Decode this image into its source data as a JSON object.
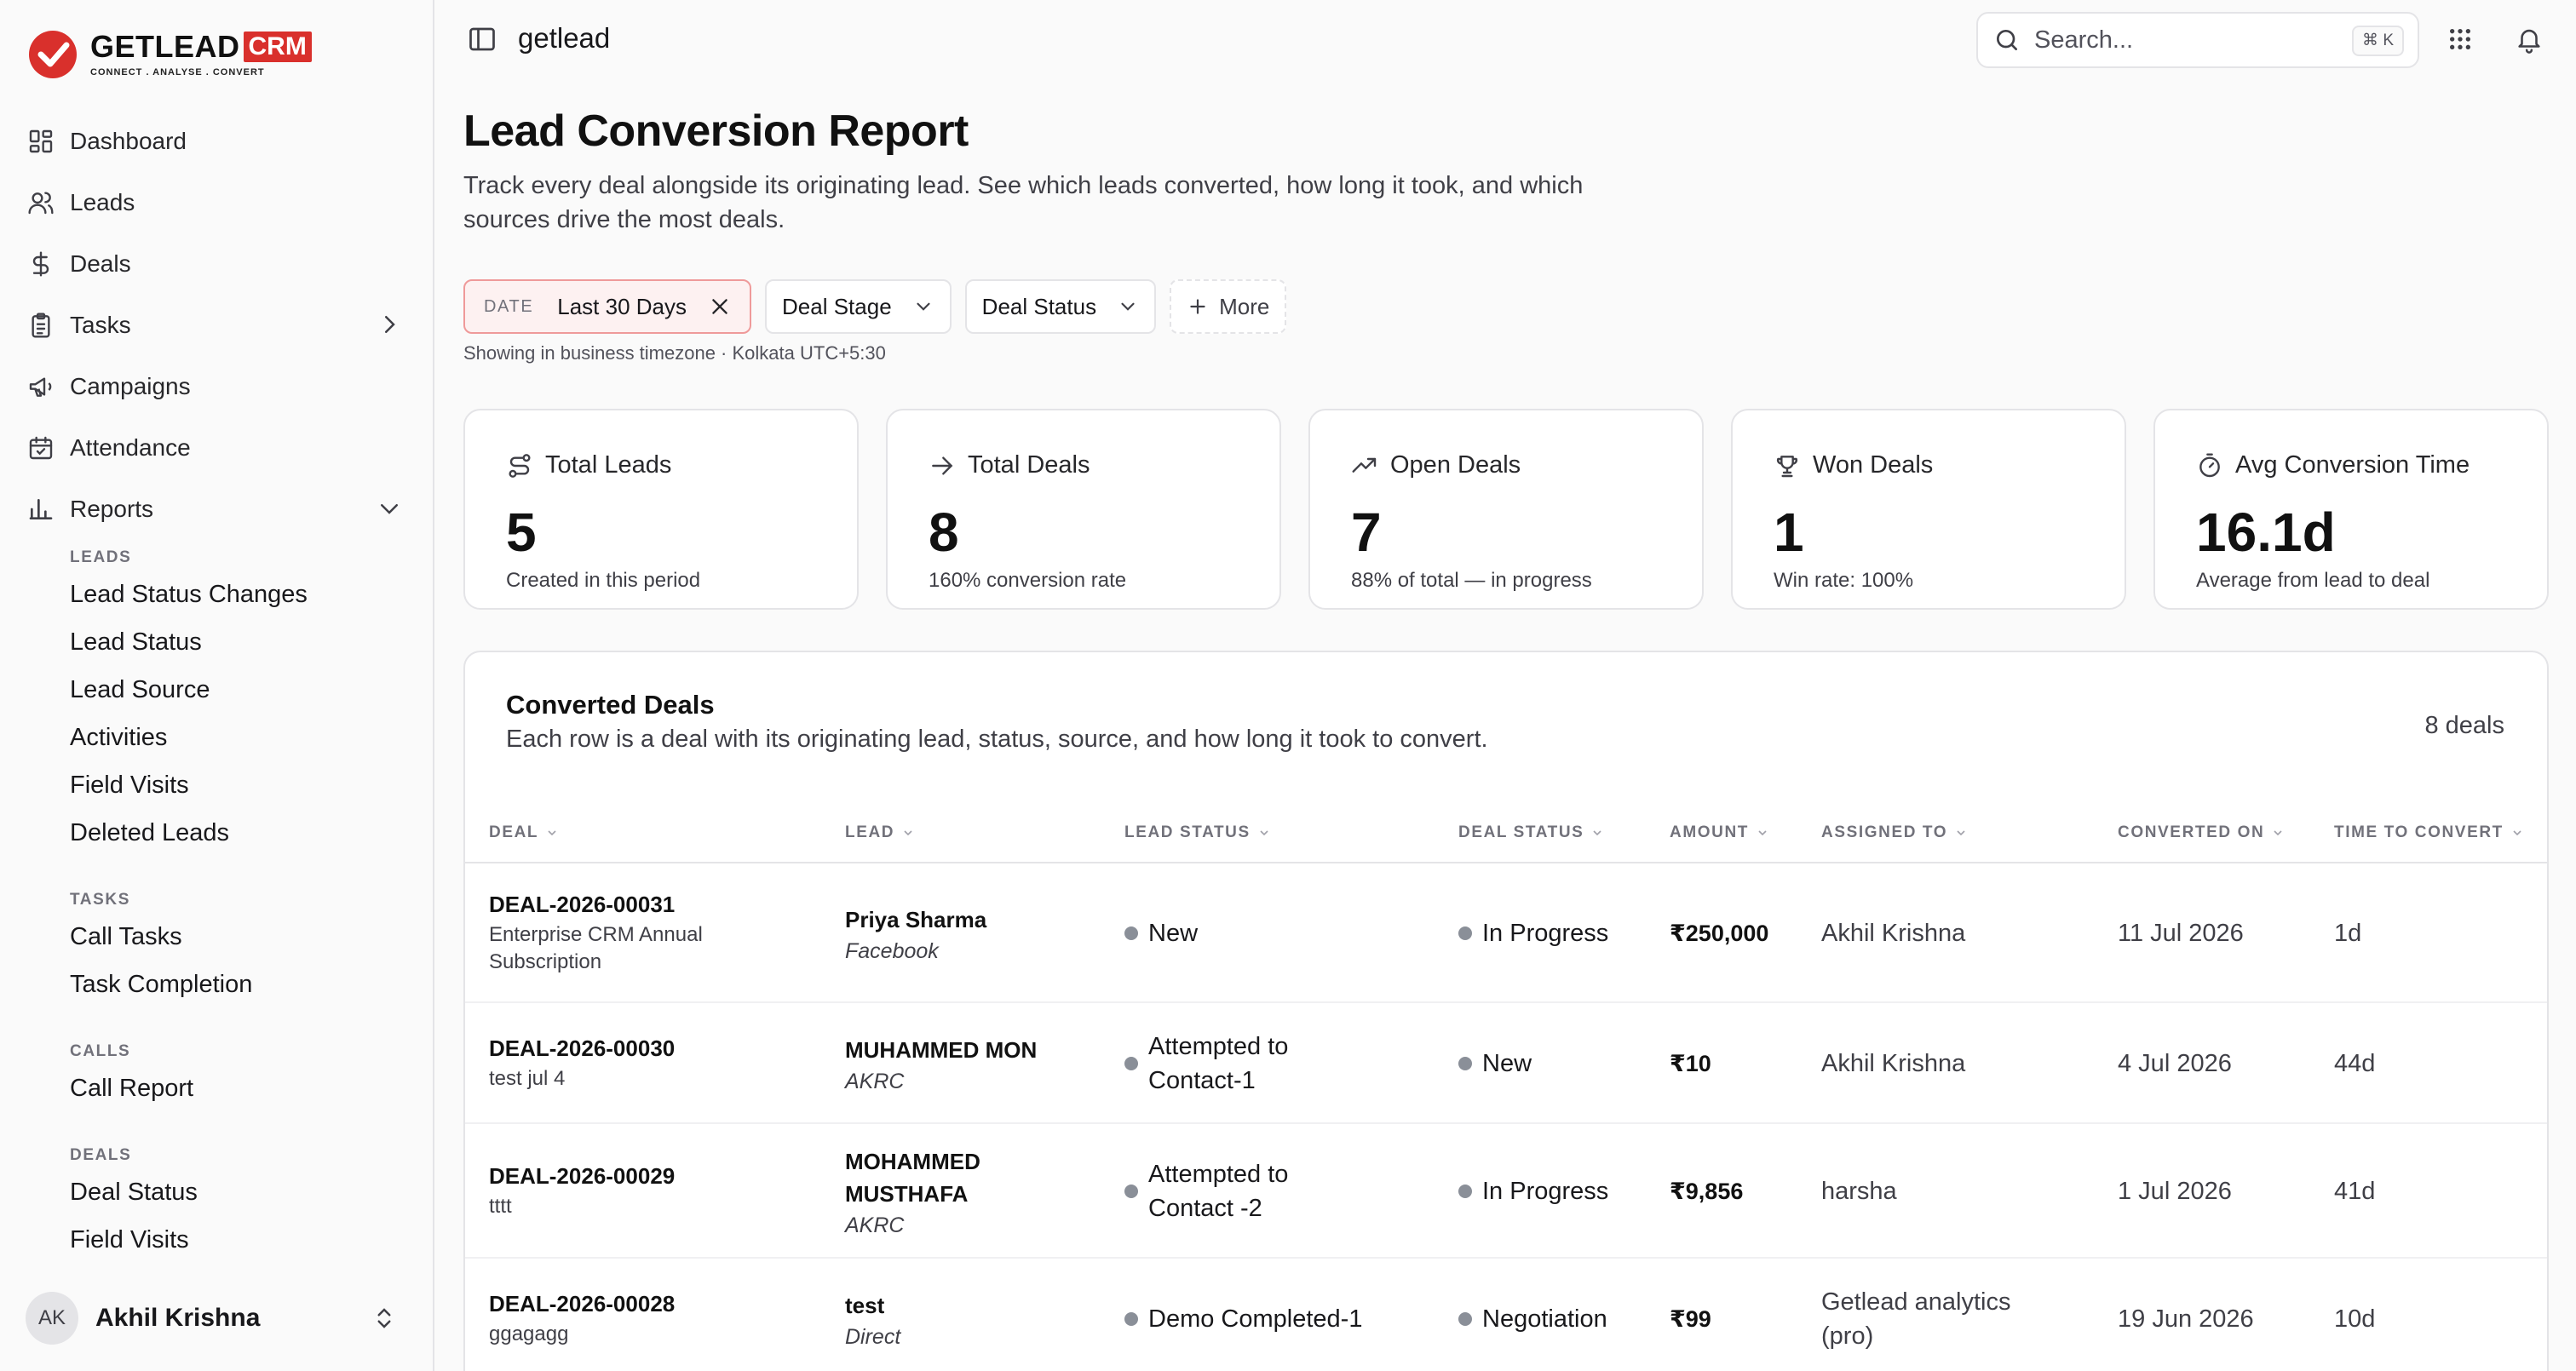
{
  "brand": {
    "name": "GETLEAD",
    "suffix": "CRM",
    "tagline": "CONNECT  .  ANALYSE  .  CONVERT",
    "accent": "#d9302c"
  },
  "sidebar": {
    "items": [
      {
        "label": "Dashboard",
        "icon": "dashboard-icon"
      },
      {
        "label": "Leads",
        "icon": "users-icon"
      },
      {
        "label": "Deals",
        "icon": "dollar-icon"
      },
      {
        "label": "Tasks",
        "icon": "clipboard-icon"
      },
      {
        "label": "Campaigns",
        "icon": "megaphone-icon"
      },
      {
        "label": "Attendance",
        "icon": "calendar-check-icon"
      },
      {
        "label": "Reports",
        "icon": "bar-chart-icon"
      }
    ],
    "reports_sections": [
      {
        "title": "LEADS",
        "items": [
          "Lead Status Changes",
          "Lead Status",
          "Lead Source",
          "Activities",
          "Field Visits",
          "Deleted Leads"
        ]
      },
      {
        "title": "TASKS",
        "items": [
          "Call Tasks",
          "Task Completion"
        ]
      },
      {
        "title": "CALLS",
        "items": [
          "Call Report"
        ]
      },
      {
        "title": "DEALS",
        "items": [
          "Deal Status",
          "Field Visits"
        ]
      }
    ],
    "user": {
      "initials": "AK",
      "name": "Akhil Krishna"
    }
  },
  "topbar": {
    "workspace": "getlead",
    "search_placeholder": "Search...",
    "search_shortcut": "⌘ K"
  },
  "page": {
    "title": "Lead Conversion Report",
    "description": "Track every deal alongside its originating lead. See which leads converted, how long it took, and which sources drive the most deals.",
    "timezone_note": "Showing in business timezone · Kolkata UTC+5:30"
  },
  "filters": {
    "date_key": "DATE",
    "date_value": "Last 30 Days",
    "deal_stage": "Deal Stage",
    "deal_status": "Deal Status",
    "more": "More"
  },
  "metrics": [
    {
      "label": "Total Leads",
      "value": "5",
      "sub": "Created in this period",
      "icon": "route-icon"
    },
    {
      "label": "Total Deals",
      "value": "8",
      "sub": "160% conversion rate",
      "icon": "arrow-right-icon"
    },
    {
      "label": "Open Deals",
      "value": "7",
      "sub": "88% of total — in progress",
      "icon": "trending-up-icon"
    },
    {
      "label": "Won Deals",
      "value": "1",
      "sub": "Win rate: 100%",
      "icon": "trophy-icon"
    },
    {
      "label": "Avg Conversion Time",
      "value": "16.1d",
      "sub": "Average from lead to deal",
      "icon": "timer-icon"
    }
  ],
  "table": {
    "title": "Converted Deals",
    "description": "Each row is a deal with its originating lead, status, source, and how long it took to convert.",
    "count": "8 deals",
    "columns": [
      "DEAL",
      "LEAD",
      "LEAD STATUS",
      "DEAL STATUS",
      "AMOUNT",
      "ASSIGNED TO",
      "CONVERTED ON",
      "TIME TO CONVERT"
    ],
    "rows": [
      {
        "deal_id": "DEAL-2026-00031",
        "deal_name": "Enterprise CRM Annual Subscription",
        "lead_name": "Priya Sharma",
        "lead_source": "Facebook",
        "lead_status": "New",
        "deal_status": "In Progress",
        "amount": "₹250,000",
        "assigned_to": "Akhil Krishna",
        "converted_on": "11 Jul 2026",
        "time_to_convert": "1d"
      },
      {
        "deal_id": "DEAL-2026-00030",
        "deal_name": "test jul 4",
        "lead_name": "MUHAMMED MON",
        "lead_source": "AKRC",
        "lead_status": "Attempted to Contact-1",
        "deal_status": "New",
        "amount": "₹10",
        "assigned_to": "Akhil Krishna",
        "converted_on": "4 Jul 2026",
        "time_to_convert": "44d"
      },
      {
        "deal_id": "DEAL-2026-00029",
        "deal_name": "tttt",
        "lead_name": "MOHAMMED MUSTHAFA",
        "lead_source": "AKRC",
        "lead_status": "Attempted to Contact -2",
        "deal_status": "In Progress",
        "amount": "₹9,856",
        "assigned_to": "harsha",
        "converted_on": "1 Jul 2026",
        "time_to_convert": "41d"
      },
      {
        "deal_id": "DEAL-2026-00028",
        "deal_name": "ggagagg",
        "lead_name": "test",
        "lead_source": "Direct",
        "lead_status": "Demo Completed-1",
        "deal_status": "Negotiation",
        "amount": "₹99",
        "assigned_to": "Getlead analytics (pro)",
        "converted_on": "19 Jun 2026",
        "time_to_convert": "10d"
      }
    ]
  }
}
